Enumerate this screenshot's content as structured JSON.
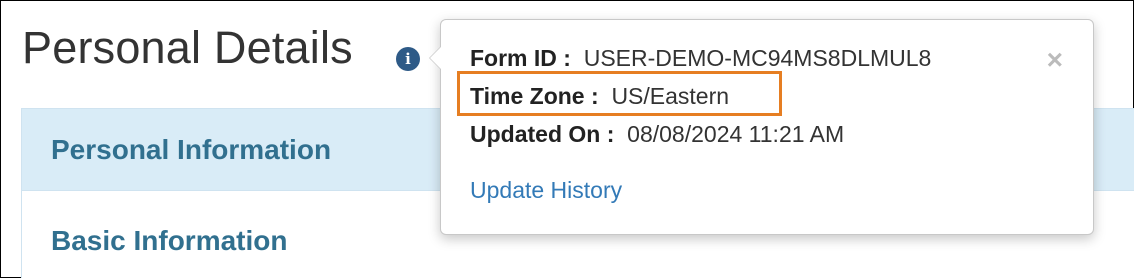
{
  "page": {
    "title": "Personal Details",
    "info_icon_glyph": "i"
  },
  "card": {
    "header_label": "Personal Information",
    "section_label": "Basic Information"
  },
  "popover": {
    "form_id_label": "Form ID :",
    "form_id_value": "USER-DEMO-MC94MS8DLMUL8",
    "time_zone_label": "Time Zone :",
    "time_zone_value": "US/Eastern",
    "updated_on_label": "Updated On :",
    "updated_on_value": "08/08/2024 11:21 AM",
    "update_history_link": "Update History",
    "close_glyph": "×"
  },
  "colors": {
    "highlight_border": "#e67e22",
    "header_bg": "#d9ecf7",
    "heading_text": "#31708f",
    "link": "#337ab7",
    "info_icon_bg": "#2e5a87"
  },
  "icons": {
    "info": "info-circle-icon",
    "close": "close-icon"
  }
}
